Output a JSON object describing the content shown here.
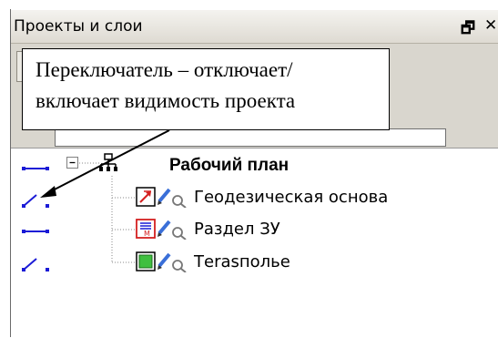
{
  "panel": {
    "title": "Проекты и слои",
    "restore_glyph": "🗗",
    "close_glyph": "✕"
  },
  "callout": {
    "line1": "Переключатель – отключает/",
    "line2": "включает видимость проекта"
  },
  "tree": {
    "expander_symbol": "⊟",
    "root": {
      "label": "Рабочий план",
      "icon": "project-tree-icon",
      "toggle": "visible"
    },
    "layers": [
      {
        "label": "Геодезическая основа",
        "icon": "geodesic-layer-icon",
        "toggle": "hidden"
      },
      {
        "label": "Раздел ЗУ",
        "icon": "section-zu-layer-icon",
        "toggle": "visible"
      },
      {
        "label": "Тerasполье",
        "icon": "terrain-layer-icon",
        "toggle": "hidden"
      }
    ]
  },
  "colors": {
    "toggle_blue": "#1b1bd6",
    "icon_red": "#d42020",
    "icon_green": "#3fbf3f",
    "pencil_blue": "#3a6fd8"
  }
}
